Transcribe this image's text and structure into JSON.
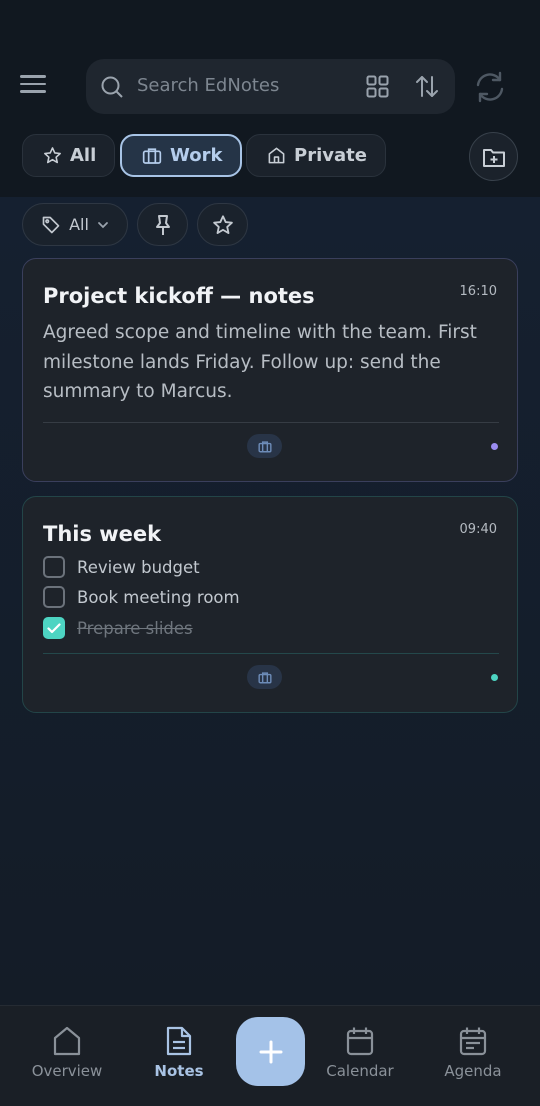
{
  "search": {
    "placeholder": "Search EdNotes"
  },
  "categories": [
    {
      "label": "All",
      "icon": "star-icon"
    },
    {
      "label": "Work",
      "icon": "briefcase-icon",
      "active": true
    },
    {
      "label": "Private",
      "icon": "home-icon"
    }
  ],
  "filters": {
    "tag_label": "All"
  },
  "notes": [
    {
      "title": "Project kickoff — notes",
      "time": "16:10",
      "body": "Agreed scope and timeline with the team. First milestone lands Friday. Follow up: send the summary to Marcus.",
      "dot_color": "#9a8cf0"
    },
    {
      "title": "This week",
      "time": "09:40",
      "items": [
        {
          "label": "Review budget",
          "checked": false
        },
        {
          "label": "Book meeting room",
          "checked": false
        },
        {
          "label": "Prepare slides",
          "checked": true
        }
      ],
      "dot_color": "#4dd4c2"
    }
  ],
  "nav": [
    {
      "label": "Overview"
    },
    {
      "label": "Notes",
      "active": true
    },
    {
      "label": "Calendar"
    },
    {
      "label": "Agenda"
    }
  ],
  "colors": {
    "accent": "#a4c2e8",
    "check": "#4dd4c2",
    "background": "#141d28"
  }
}
